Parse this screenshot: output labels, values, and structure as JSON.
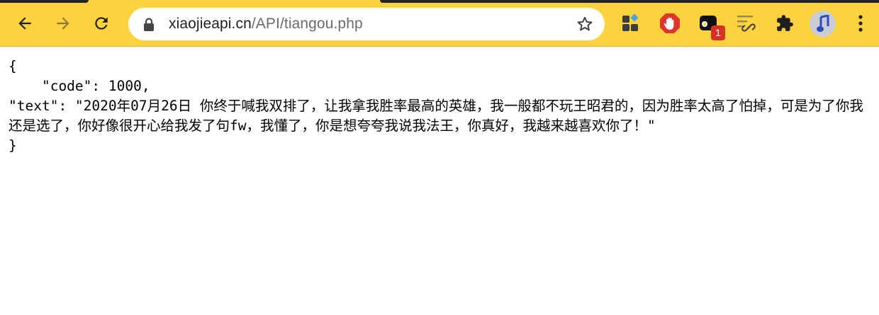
{
  "browser": {
    "url_host": "xiaojieapi.cn",
    "url_path": "/API/tiangou.php",
    "extension_badge": "1",
    "icons": {
      "back": "arrow-left-icon",
      "forward": "arrow-right-icon",
      "reload": "reload-icon",
      "lock": "lock-icon",
      "bookmark": "star-icon",
      "menu": "kebab-menu-icon"
    },
    "colors": {
      "toolbar": "#fcd23f",
      "badge": "#d93025",
      "stop_ext": "#e0332b"
    }
  },
  "page": {
    "open_brace": "{",
    "code_line": "    \"code\": 1000,",
    "text_line": "    \"text\": \"2020年07月26日 你终于喊我双排了，让我拿我胜率最高的英雄，我一般都不玩王昭君的，因为胜率太高了怕掉，可是为了你我还是选了，你好像很开心给我发了句fw，我懂了，你是想夸夸我说我法王，你真好，我越来越喜欢你了！\"",
    "close_brace": "}"
  }
}
